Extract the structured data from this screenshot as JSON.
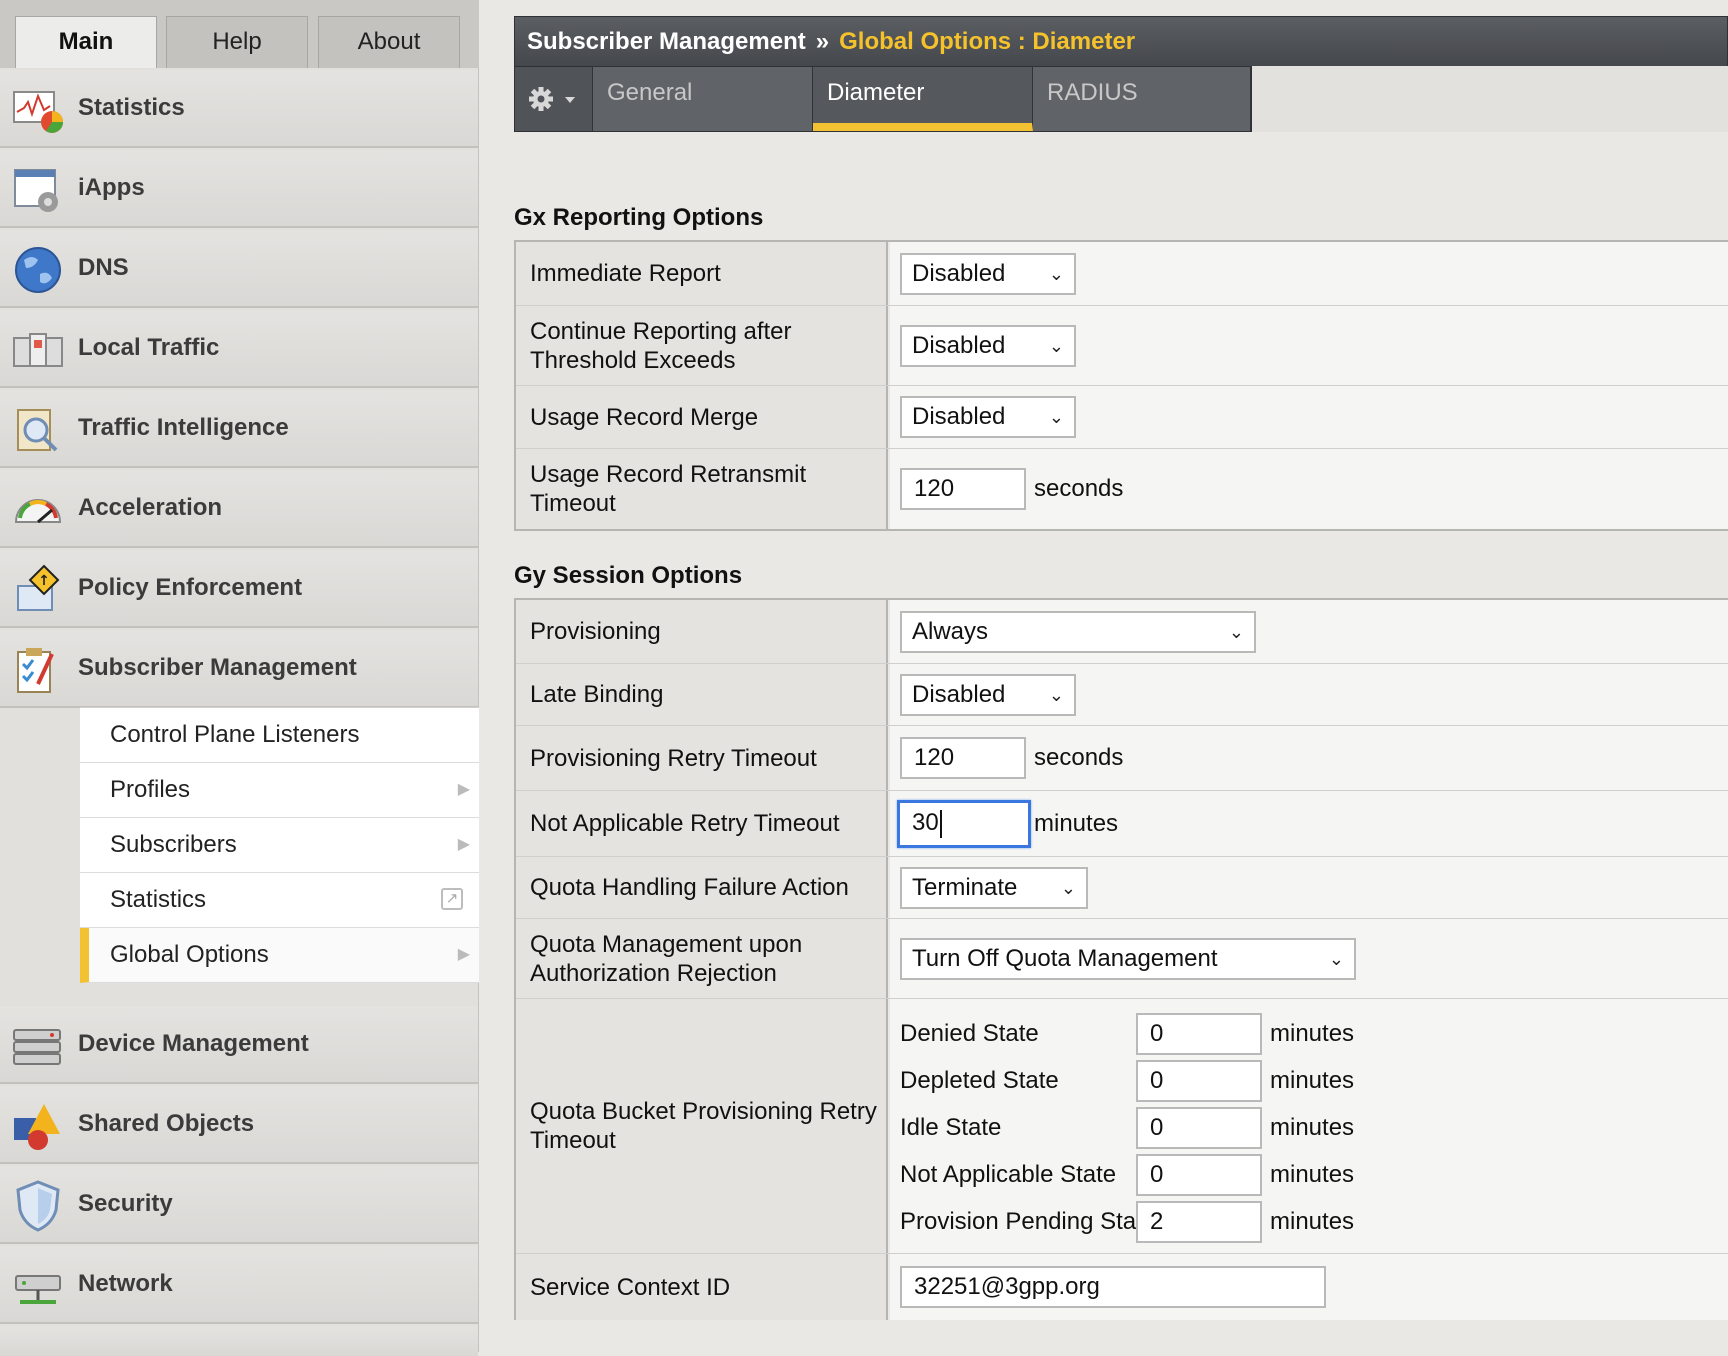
{
  "nav_tabs": [
    {
      "label": "Main",
      "active": true
    },
    {
      "label": "Help",
      "active": false
    },
    {
      "label": "About",
      "active": false
    }
  ],
  "sidebar": {
    "items": [
      {
        "label": "Statistics",
        "icon": "statistics-icon"
      },
      {
        "label": "iApps",
        "icon": "iapps-icon"
      },
      {
        "label": "DNS",
        "icon": "globe-icon"
      },
      {
        "label": "Local Traffic",
        "icon": "local-traffic-icon"
      },
      {
        "label": "Traffic Intelligence",
        "icon": "traffic-intelligence-icon"
      },
      {
        "label": "Acceleration",
        "icon": "gauge-icon"
      },
      {
        "label": "Policy Enforcement",
        "icon": "policy-sign-icon"
      },
      {
        "label": "Subscriber Management",
        "icon": "clipboard-check-icon"
      },
      {
        "label": "Device Management",
        "icon": "device-stack-icon"
      },
      {
        "label": "Shared Objects",
        "icon": "shapes-icon"
      },
      {
        "label": "Security",
        "icon": "shield-icon"
      },
      {
        "label": "Network",
        "icon": "network-icon"
      }
    ],
    "sub_items": [
      {
        "label": "Control Plane Listeners",
        "marker": ""
      },
      {
        "label": "Profiles",
        "marker": "arrow"
      },
      {
        "label": "Subscribers",
        "marker": "arrow"
      },
      {
        "label": "Statistics",
        "marker": "external"
      },
      {
        "label": "Global Options",
        "marker": "arrow",
        "active": true
      }
    ]
  },
  "header": {
    "section": "Subscriber Management",
    "separator": "»",
    "page": "Global Options : Diameter"
  },
  "tabs": [
    {
      "label": "General",
      "active": false
    },
    {
      "label": "Diameter",
      "active": true
    },
    {
      "label": "RADIUS",
      "active": false
    }
  ],
  "gx": {
    "title": "Gx Reporting Options",
    "immediate_report": {
      "label": "Immediate Report",
      "value": "Disabled"
    },
    "continue_reporting": {
      "label": "Continue Reporting after Threshold Exceeds",
      "value": "Disabled"
    },
    "usage_record_merge": {
      "label": "Usage Record Merge",
      "value": "Disabled"
    },
    "retransmit_timeout": {
      "label": "Usage Record Retransmit Timeout",
      "value": "120",
      "unit": "seconds"
    }
  },
  "gy": {
    "title": "Gy Session Options",
    "provisioning": {
      "label": "Provisioning",
      "value": "Always"
    },
    "late_binding": {
      "label": "Late Binding",
      "value": "Disabled"
    },
    "provisioning_retry": {
      "label": "Provisioning Retry Timeout",
      "value": "120",
      "unit": "seconds"
    },
    "not_applicable_retry": {
      "label": "Not Applicable Retry Timeout",
      "value": "30",
      "unit": "minutes"
    },
    "quota_failure": {
      "label": "Quota Handling Failure Action",
      "value": "Terminate"
    },
    "quota_mgmt": {
      "label": "Quota Management upon Authorization Rejection",
      "value": "Turn Off Quota Management"
    },
    "quota_bucket": {
      "label": "Quota Bucket Provisioning Retry Timeout",
      "states": [
        {
          "label": "Denied State",
          "value": "0",
          "unit": "minutes"
        },
        {
          "label": "Depleted State",
          "value": "0",
          "unit": "minutes"
        },
        {
          "label": "Idle State",
          "value": "0",
          "unit": "minutes"
        },
        {
          "label": "Not Applicable State",
          "value": "0",
          "unit": "minutes"
        },
        {
          "label": "Provision Pending State",
          "value": "2",
          "unit": "minutes"
        }
      ]
    },
    "service_context": {
      "label": "Service Context ID",
      "value": "32251@3gpp.org"
    }
  },
  "colors": {
    "accent": "#f2c232",
    "header_bg": "#4f5256",
    "focus": "#3a78e0"
  }
}
